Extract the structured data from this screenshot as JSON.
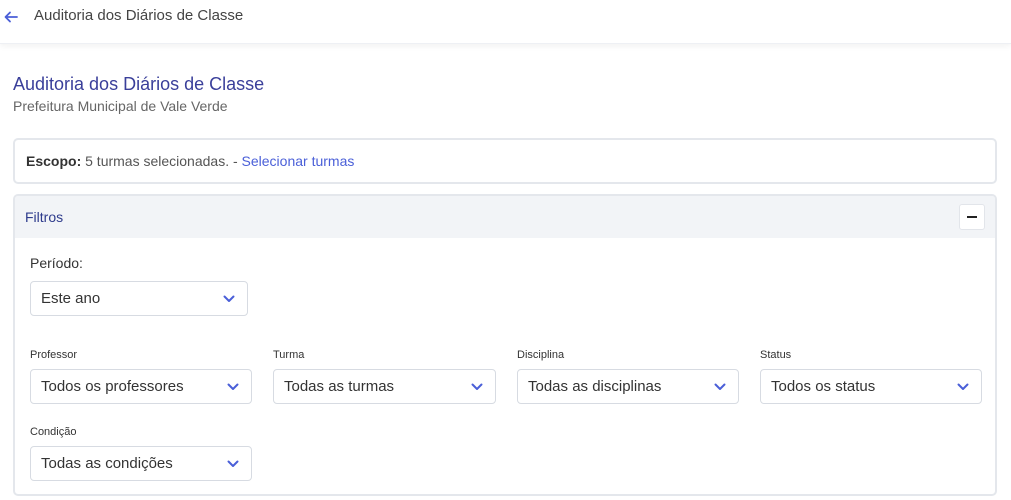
{
  "topbar": {
    "title": "Auditoria dos Diários de Classe"
  },
  "page": {
    "title": "Auditoria dos Diários de Classe",
    "subtitle": "Prefeitura Municipal de Vale Verde"
  },
  "scope": {
    "label": "Escopo:",
    "text": " 5 turmas selecionadas. - ",
    "link": "Selecionar turmas"
  },
  "filters": {
    "title": "Filtros",
    "periodo": {
      "label": "Período:",
      "value": "Este ano"
    },
    "professor": {
      "label": "Professor",
      "value": "Todos os professores"
    },
    "turma": {
      "label": "Turma",
      "value": "Todas as turmas"
    },
    "disciplina": {
      "label": "Disciplina",
      "value": "Todas as disciplinas"
    },
    "status": {
      "label": "Status",
      "value": "Todos os status"
    },
    "condicao": {
      "label": "Condição",
      "value": "Todas as condições"
    }
  },
  "colors": {
    "accent": "#4a5fd8",
    "title": "#3a3f9a",
    "border": "#e4e7ec",
    "header_bg": "#f2f4f7"
  }
}
